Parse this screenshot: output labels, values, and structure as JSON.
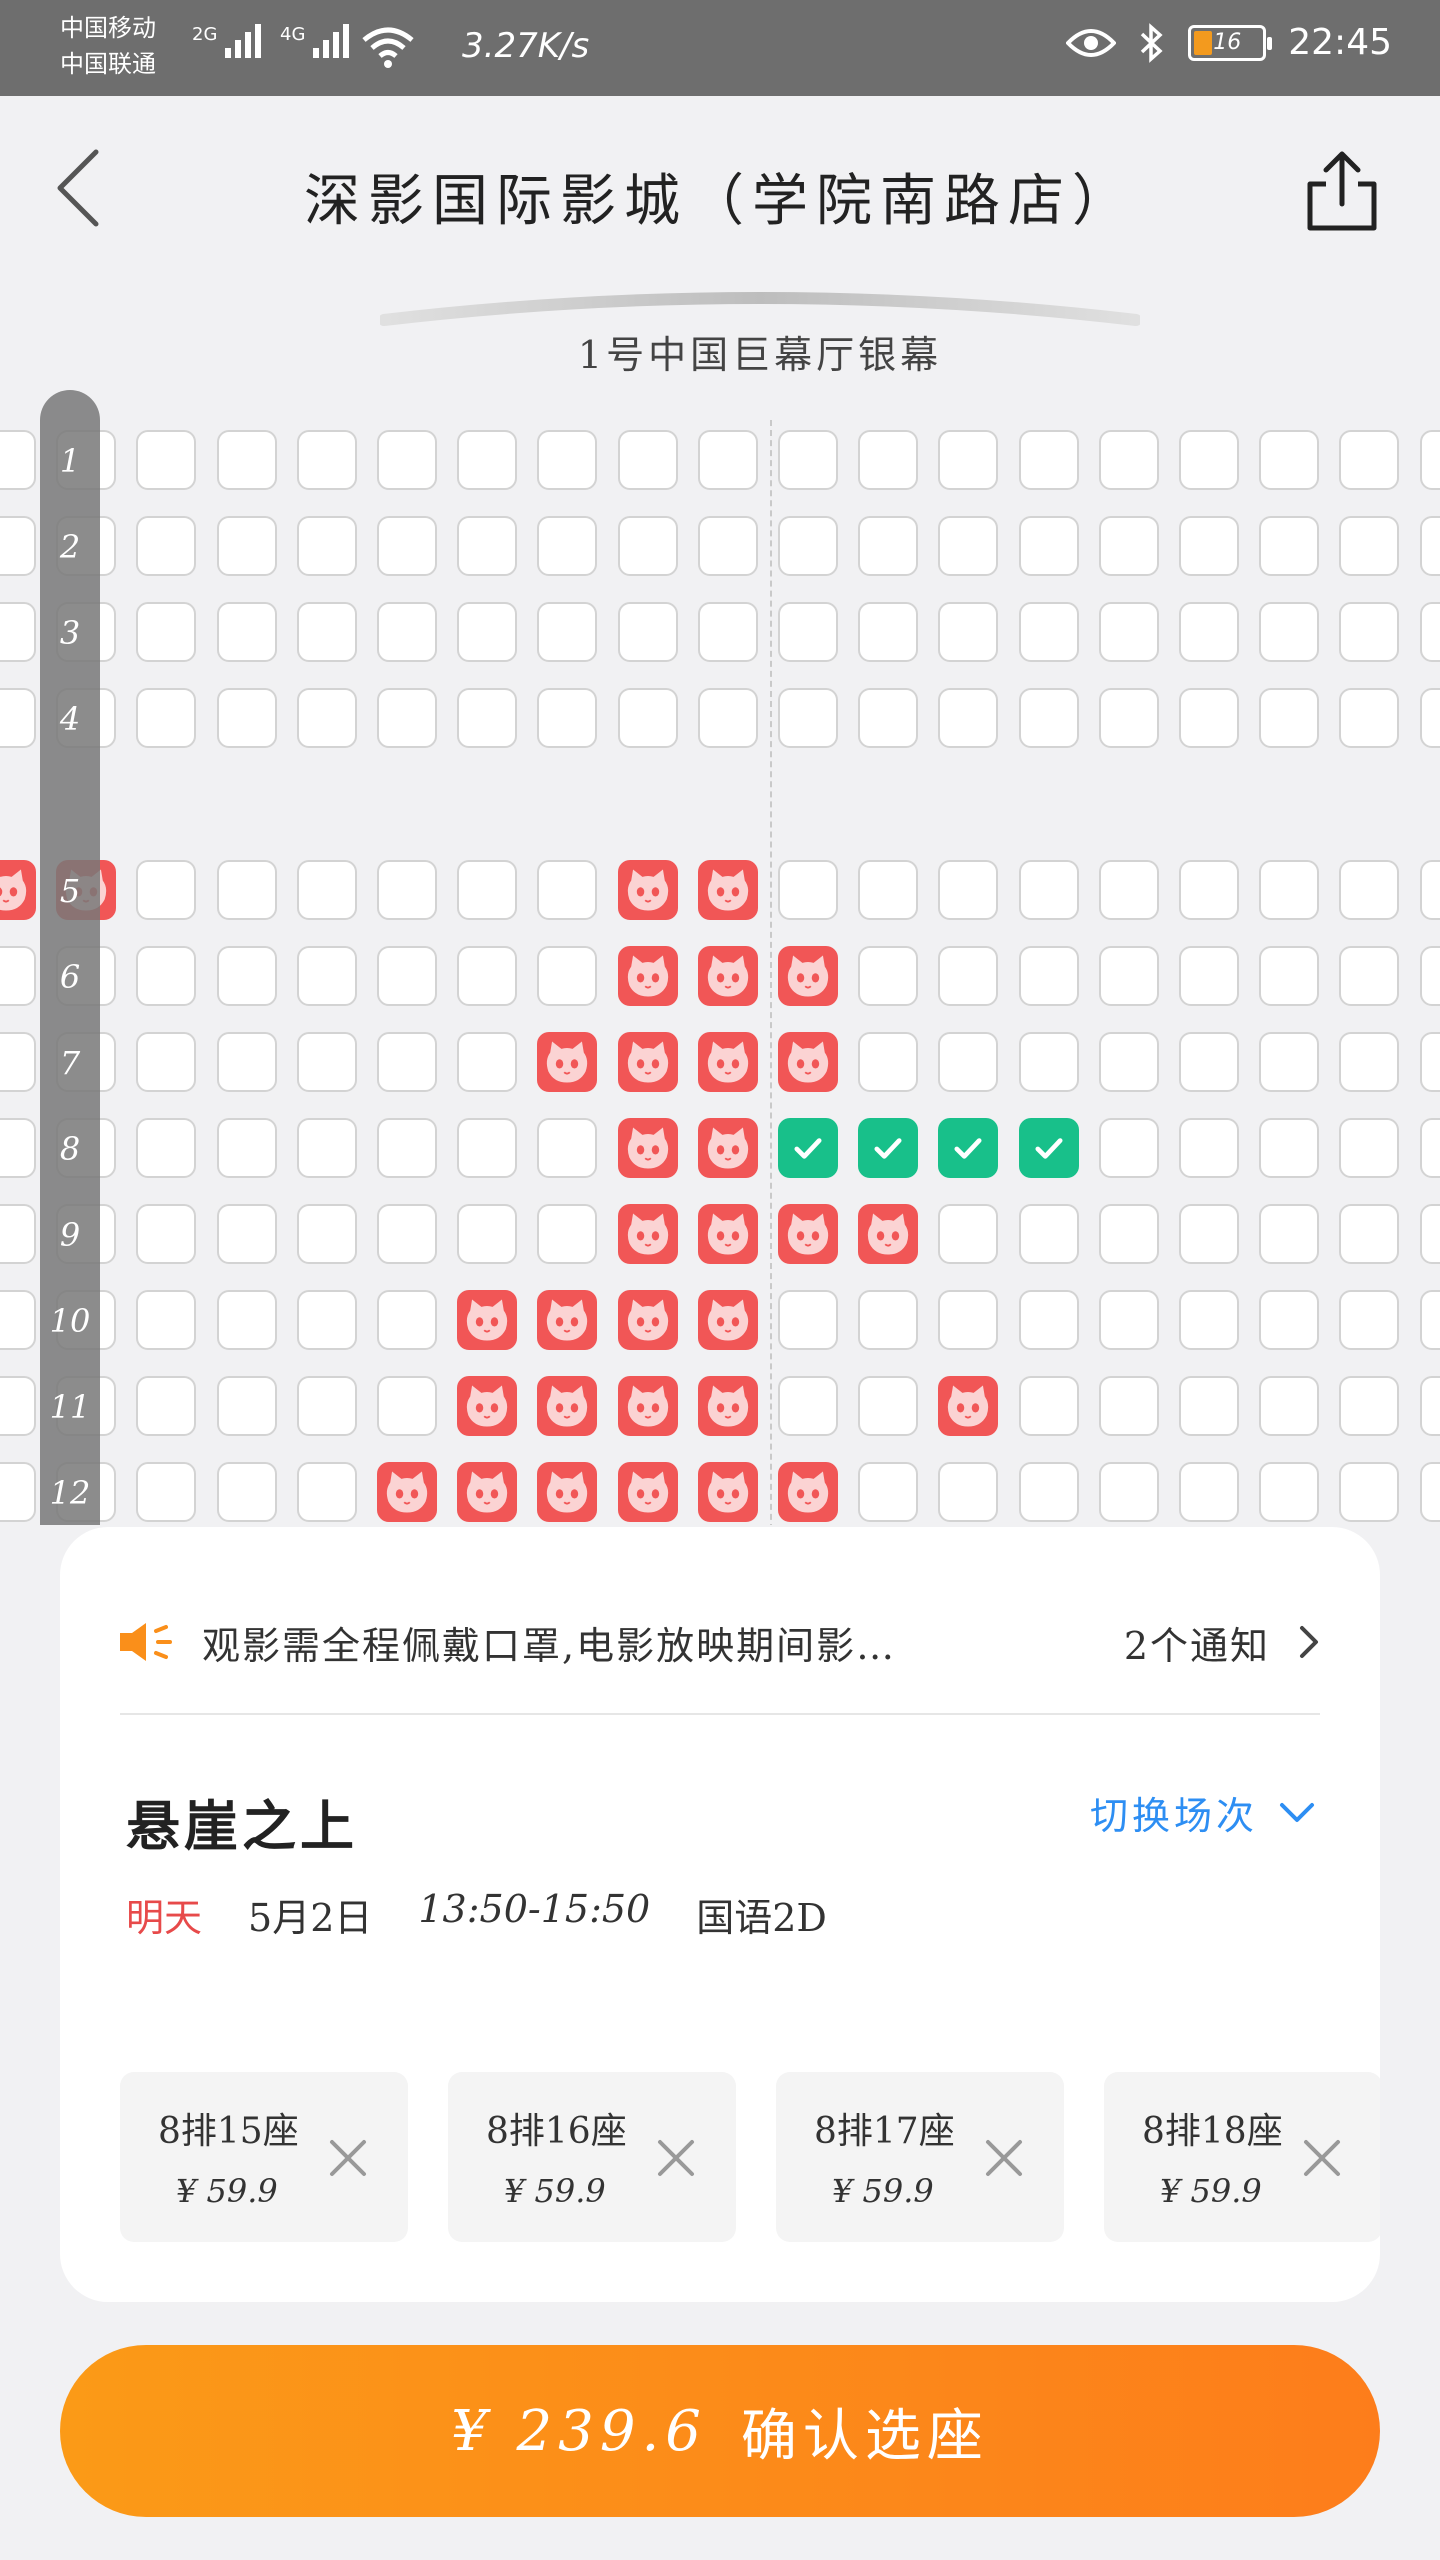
{
  "status_bar": {
    "carrier_1": "中国移动",
    "carrier_2": "中国联通",
    "sig1_label": "2G",
    "sig2_label": "4G",
    "speed": "3.27K/s",
    "battery": "16",
    "time": "22:45"
  },
  "header": {
    "title": "深影国际影城（学院南路店）",
    "screen_label": "1号中国巨幕厅银幕"
  },
  "rows": [
    "1",
    "2",
    "3",
    "4",
    "5",
    "6",
    "7",
    "8",
    "9",
    "10",
    "11",
    "12"
  ],
  "seat_map": [
    "......................",
    "......................",
    "......................",
    "......................",
    "SS......SS............",
    "........SSS...........",
    ".......SSSS...........",
    "........SSVVVV........",
    "........SSSS..........",
    "......SSSS............",
    "......SSSS..S.........",
    ".....SSSSSS..........."
  ],
  "seat_legend": {
    "available": ".",
    "sold": "S",
    "selected": "V"
  },
  "colors": {
    "sold": "#f15656",
    "selected": "#18c08a",
    "accent": "#fd8a19",
    "link": "#2d8ef3",
    "today": "#e74a4a"
  },
  "notice": {
    "text": "观影需全程佩戴口罩,电影放映期间影…",
    "count": "2个通知"
  },
  "movie": {
    "title": "悬崖之上",
    "switch_label": "切换场次",
    "day": "明天",
    "date": "5月2日",
    "time": "13:50-15:50",
    "format": "国语2D"
  },
  "tickets": [
    {
      "seat": "8排15座",
      "price": "¥ 59.9"
    },
    {
      "seat": "8排16座",
      "price": "¥ 59.9"
    },
    {
      "seat": "8排17座",
      "price": "¥ 59.9"
    },
    {
      "seat": "8排18座",
      "price": "¥ 59.9"
    }
  ],
  "confirm": {
    "amount": "¥ 239.6",
    "label": "确认选座"
  },
  "icons": [
    "back-icon",
    "share-icon",
    "speaker-icon",
    "chevron-right-icon",
    "chevron-down-icon",
    "close-icon",
    "cat-icon",
    "check-icon",
    "wifi-icon",
    "eye-icon",
    "bluetooth-icon",
    "battery-icon"
  ]
}
